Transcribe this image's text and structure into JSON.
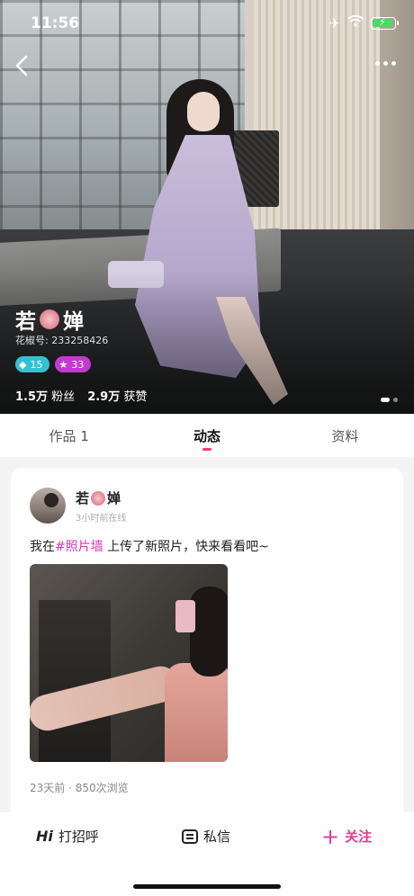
{
  "status_bar": {
    "time": "11:56"
  },
  "profile": {
    "name_prefix": "若",
    "name_suffix": "婵",
    "id_label": "花椒号: 233258426",
    "badges": [
      {
        "icon": "diamond-icon",
        "value": "15",
        "color": "#35c1d4"
      },
      {
        "icon": "star-icon",
        "value": "33",
        "color": "#c33acf"
      }
    ],
    "fans_count": "1.5万",
    "fans_label": "粉丝",
    "likes_count": "2.9万",
    "likes_label": "获赞"
  },
  "tabs": [
    {
      "label": "作品 1"
    },
    {
      "label": "动态",
      "active": true
    },
    {
      "label": "资料"
    }
  ],
  "post": {
    "name_prefix": "若",
    "name_suffix": "婵",
    "time": "3小时前在线",
    "text_before": "我在",
    "tag": "#照片墙",
    "text_after": " 上传了新照片，快来看看吧~",
    "meta": "23天前 · 850次浏览"
  },
  "bottom_bar": {
    "hi_icon": "Hi",
    "greet_label": "打招呼",
    "message_label": "私信",
    "follow_label": "关注"
  },
  "colors": {
    "accent": "#e23c8e",
    "tag": "#d33ab8",
    "tab_indicator": "#ef4161"
  }
}
